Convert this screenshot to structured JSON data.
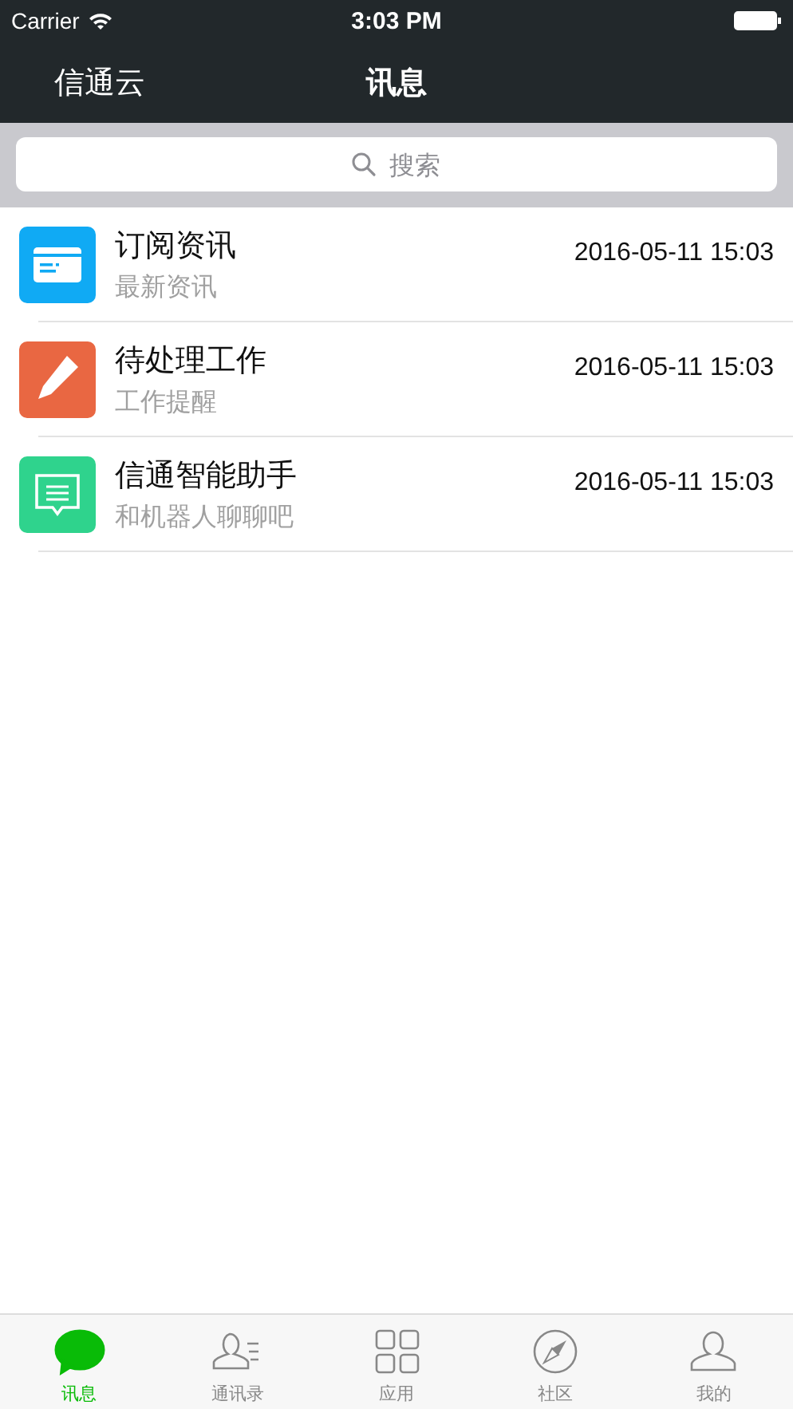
{
  "status_bar": {
    "carrier": "Carrier",
    "time": "3:03 PM"
  },
  "nav_bar": {
    "left": "信通云",
    "title": "讯息"
  },
  "search": {
    "placeholder": "搜索"
  },
  "messages": [
    {
      "kind": "card",
      "color": "#10aaf4",
      "title": "订阅资讯",
      "subtitle": "最新资讯",
      "time": "2016-05-11 15:03"
    },
    {
      "kind": "pencil",
      "color": "#e96742",
      "title": "待处理工作",
      "subtitle": "工作提醒",
      "time": "2016-05-11 15:03"
    },
    {
      "kind": "chat",
      "color": "#2fd38d",
      "title": "信通智能助手",
      "subtitle": "和机器人聊聊吧",
      "time": "2016-05-11 15:03"
    }
  ],
  "tab_bar": [
    {
      "kind": "chat",
      "label": "讯息",
      "selected": true
    },
    {
      "kind": "contacts",
      "label": "通讯录",
      "selected": false
    },
    {
      "kind": "apps",
      "label": "应用",
      "selected": false
    },
    {
      "kind": "compass",
      "label": "社区",
      "selected": false
    },
    {
      "kind": "person",
      "label": "我的",
      "selected": false
    }
  ]
}
